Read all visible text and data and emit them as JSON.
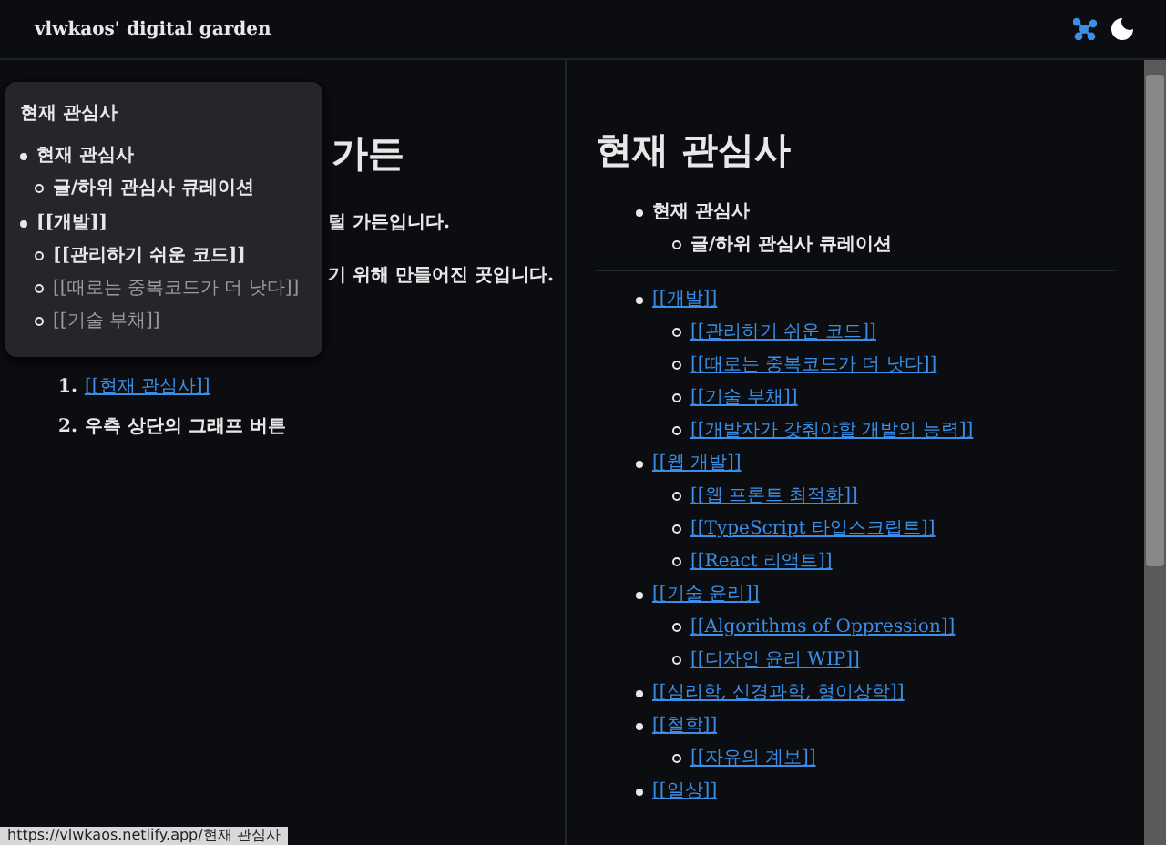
{
  "header": {
    "title": "vlwkaos' digital garden"
  },
  "left_page": {
    "heading_visible": "가든",
    "paragraphs": [
      "털 가든입니다.",
      "기 위해 만들어진 곳입니다."
    ],
    "steps": [
      {
        "num": "1.",
        "text": "[[현재 관심사]]",
        "kind": "link"
      },
      {
        "num": "2.",
        "text": "우측 상단의 그래프 버튼",
        "kind": "text"
      }
    ]
  },
  "preview_popover": {
    "title": "현재 관심사",
    "items": [
      {
        "text": "현재 관심사",
        "kind": "text",
        "children": [
          {
            "text": "글/하위 관심사 큐레이션",
            "kind": "text"
          }
        ]
      },
      {
        "text": "[[개발]]",
        "kind": "text",
        "children": [
          {
            "text": "[[관리하기 쉬운 코드]]",
            "kind": "text"
          },
          {
            "text": "[[때로는 중복코드가 더 낫다]]",
            "kind": "text"
          },
          {
            "text": "[[기술 부채]]",
            "kind": "text"
          }
        ]
      }
    ]
  },
  "right_page": {
    "heading": "현재 관심사",
    "intro": [
      {
        "text": "현재 관심사",
        "kind": "text",
        "children": [
          {
            "text": "글/하위 관심사 큐레이션",
            "kind": "text"
          }
        ]
      }
    ],
    "topics": [
      {
        "text": "[[개발]]",
        "kind": "link",
        "children": [
          {
            "text": "[[관리하기 쉬운 코드]]",
            "kind": "link"
          },
          {
            "text": "[[때로는 중복코드가 더 낫다]]",
            "kind": "link"
          },
          {
            "text": "[[기술 부채]]",
            "kind": "link"
          },
          {
            "text": "[[개발자가 갖춰야할 개발의 능력]]",
            "kind": "link"
          }
        ]
      },
      {
        "text": "[[웹 개발]]",
        "kind": "link",
        "children": [
          {
            "text": "[[웹 프론트 최적화]]",
            "kind": "link"
          },
          {
            "text": "[[TypeScript 타입스크립트]]",
            "kind": "link"
          },
          {
            "text": "[[React 리액트]]",
            "kind": "link"
          }
        ]
      },
      {
        "text": "[[기술 윤리]]",
        "kind": "link",
        "children": [
          {
            "text": "[[Algorithms of Oppression]]",
            "kind": "link"
          },
          {
            "text": "[[디자인 윤리 WIP]]",
            "kind": "link"
          }
        ]
      },
      {
        "text": "[[심리학, 신경과학, 형이상학]]",
        "kind": "link"
      },
      {
        "text": "[[철학]]",
        "kind": "link",
        "children": [
          {
            "text": "[[자유의 계보]]",
            "kind": "link"
          }
        ]
      },
      {
        "text": "[[일상]]",
        "kind": "link"
      }
    ]
  },
  "status_url": "https://vlwkaos.netlify.app/현재 관심사"
}
